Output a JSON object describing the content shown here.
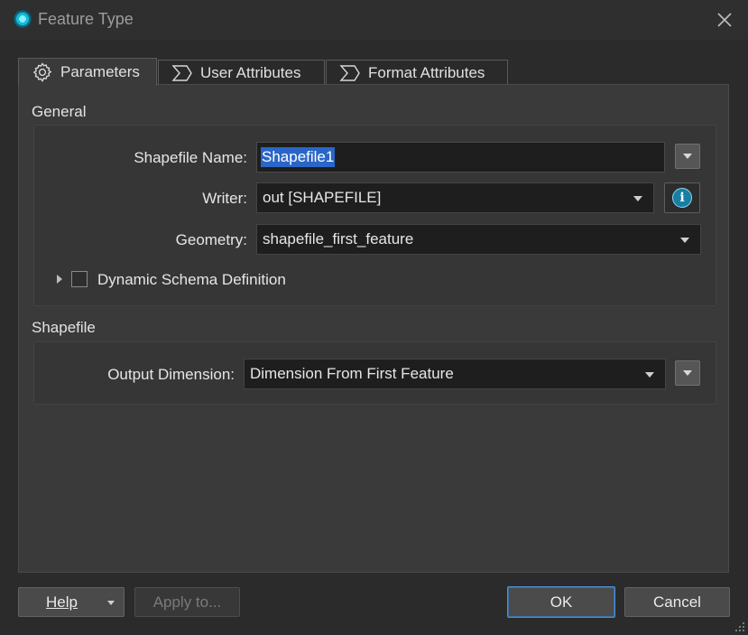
{
  "window": {
    "title": "Feature Type"
  },
  "tabs": [
    {
      "label": "Parameters",
      "icon": "gear-icon",
      "active": true
    },
    {
      "label": "User Attributes",
      "icon": "sigma-icon",
      "active": false
    },
    {
      "label": "Format Attributes",
      "icon": "sigma-icon",
      "active": false
    }
  ],
  "general": {
    "heading": "General",
    "shapefile_name": {
      "label": "Shapefile Name:",
      "value": "Shapefile1"
    },
    "writer": {
      "label": "Writer:",
      "value": "out [SHAPEFILE]"
    },
    "geometry": {
      "label": "Geometry:",
      "value": "shapefile_first_feature"
    },
    "dynamic_schema": {
      "label": "Dynamic Schema Definition",
      "checked": false
    }
  },
  "shapefile": {
    "heading": "Shapefile",
    "output_dimension": {
      "label": "Output Dimension:",
      "value": "Dimension From First Feature"
    }
  },
  "buttons": {
    "help": "Help",
    "apply": "Apply to...",
    "ok": "OK",
    "cancel": "Cancel"
  },
  "colors": {
    "accent": "#4b8fd6",
    "selection": "#2a66c8",
    "info": "#177fa3"
  }
}
